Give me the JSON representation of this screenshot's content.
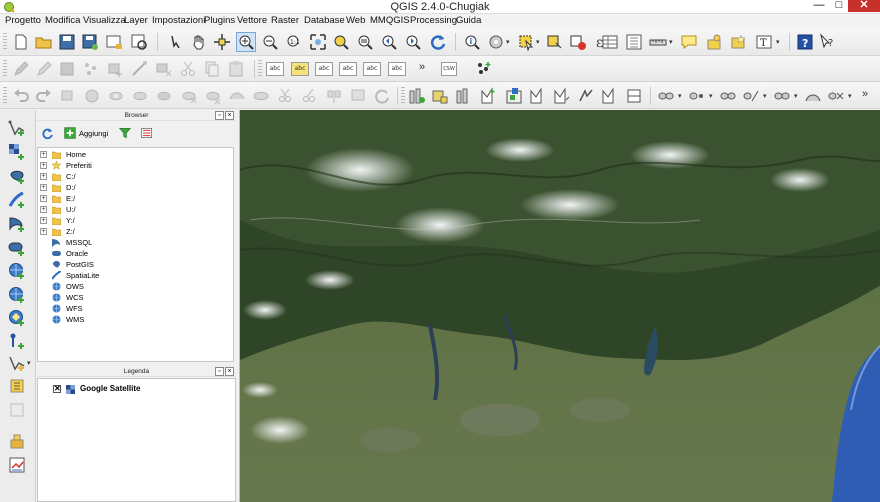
{
  "window": {
    "title": "QGIS 2.4.0-Chugiak",
    "minimize_label": "—",
    "maximize_label": "□",
    "close_label": "✕"
  },
  "menubar": {
    "items": [
      "Progetto",
      "Modifica",
      "Visualizza",
      "Layer",
      "Impostazioni",
      "Plugins",
      "Vettore",
      "Raster",
      "Database",
      "Web",
      "MMQGIS",
      "Processing",
      "Guida"
    ]
  },
  "toolbar2": {
    "abc_labels": [
      "abc",
      "abc",
      "abc",
      "abc",
      "abc",
      "abc"
    ],
    "more_label": "»",
    "csw_label": "CSW"
  },
  "browser": {
    "title": "Browser",
    "add_label": "Aggiungi",
    "items": [
      {
        "label": "Home",
        "icon": "home-folder-icon",
        "expandable": true
      },
      {
        "label": "Preferiti",
        "icon": "favorites-star-icon",
        "expandable": true
      },
      {
        "label": "C:/",
        "icon": "folder-icon",
        "expandable": true
      },
      {
        "label": "D:/",
        "icon": "folder-icon",
        "expandable": true
      },
      {
        "label": "E:/",
        "icon": "folder-icon",
        "expandable": true
      },
      {
        "label": "U:/",
        "icon": "folder-icon",
        "expandable": true
      },
      {
        "label": "Y:/",
        "icon": "folder-icon",
        "expandable": true
      },
      {
        "label": "Z:/",
        "icon": "folder-icon",
        "expandable": true
      },
      {
        "label": "MSSQL",
        "icon": "mssql-icon",
        "expandable": false
      },
      {
        "label": "Oracle",
        "icon": "oracle-icon",
        "expandable": false
      },
      {
        "label": "PostGIS",
        "icon": "postgis-icon",
        "expandable": false
      },
      {
        "label": "SpatiaLite",
        "icon": "spatialite-icon",
        "expandable": false
      },
      {
        "label": "OWS",
        "icon": "ows-globe-icon",
        "expandable": false
      },
      {
        "label": "WCS",
        "icon": "wcs-globe-icon",
        "expandable": false
      },
      {
        "label": "WFS",
        "icon": "wfs-globe-icon",
        "expandable": false
      },
      {
        "label": "WMS",
        "icon": "wms-globe-icon",
        "expandable": false
      }
    ]
  },
  "legend": {
    "title": "Legenda",
    "layers": [
      {
        "label": "Google Satellite",
        "checked": true
      }
    ]
  },
  "colors": {
    "close_red": "#c7312b",
    "map_alps": "#3f5533",
    "map_plain": "#6d7a52",
    "sea": "#2f5db3"
  }
}
